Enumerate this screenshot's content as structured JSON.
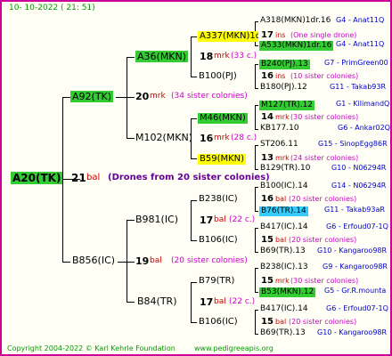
{
  "header": {
    "date": "10-  10-2022 (  21:  51)"
  },
  "footer": {
    "copyright": "Copyright 2004-2022 © Karl Kehrle Foundation",
    "site": "www.pedigreeapis.org"
  },
  "colors": {
    "green": "#33cc33",
    "yellow": "#ffff00",
    "cyan": "#33ccff",
    "frame": "#cc0099"
  },
  "root": {
    "id": "A20(TK)",
    "gen_num": "21",
    "mark": "bal",
    "note": "(Drones from 20 sister colonies)"
  },
  "sire": {
    "id": "A92(TK)",
    "gen_num": "20",
    "mark": "mrk",
    "note": "(34 sister colonies)",
    "s": {
      "id": "A36(MKN)",
      "gen_num": "18",
      "mark": "mrk",
      "note": "(33 c.)",
      "s": {
        "id": "A337(MKN)1dr",
        "gen_num": "17",
        "mark": "ins",
        "note": "(One single drone)",
        "s": {
          "id": "A318(MKN)1dr.16",
          "g": "G4 - Anat11Q"
        },
        "d": {
          "id": "A533(MKN)1dr.16",
          "g": "G4 - Anat11Q"
        }
      },
      "d": {
        "id": "B100(PJ)",
        "gen_num": "16",
        "mark": "ins",
        "note": "(10 sister colonies)",
        "s": {
          "id": "B240(PJ).13",
          "g": "G7 - PrimGreen00"
        },
        "d": {
          "id": "B180(PJ).12",
          "g": "G11 - Takab93R"
        }
      }
    },
    "d": {
      "id": "M102(MKN)",
      "gen_num": "16",
      "mark": "mrk",
      "note": "(28 c.)",
      "s": {
        "id": "M46(MKN)",
        "gen_num": "14",
        "mark": "mrk",
        "note": "(30 sister colonies)",
        "s": {
          "id": "M127(TR).12",
          "g": "G1 - KilimandQ"
        },
        "d": {
          "id": "KB177.10",
          "g": "G6 - Ankar02Q"
        }
      },
      "d": {
        "id": "B59(MKN)",
        "gen_num": "13",
        "mark": "mrk",
        "note": "(24 sister colonies)",
        "s": {
          "id": "ST206.11",
          "g": "G15 - SinopEgg86R"
        },
        "d": {
          "id": "B129(TR).10",
          "g": "G10 - N06294R"
        }
      }
    }
  },
  "dam": {
    "id": "B856(IC)",
    "gen_num": "19",
    "mark": "bal",
    "note": "(20 sister colonies)",
    "s": {
      "id": "B981(IC)",
      "gen_num": "17",
      "mark": "bal",
      "note": "(22 c.)",
      "s": {
        "id": "B238(IC)",
        "gen_num": "16",
        "mark": "bal",
        "note": "(20 sister colonies)",
        "s": {
          "id": "B100(IC).14",
          "g": "G14 - N06294R"
        },
        "d": {
          "id": "B76(TR).14",
          "g": "G11 - Takab93aR"
        }
      },
      "d": {
        "id": "B106(IC)",
        "gen_num": "15",
        "mark": "bal",
        "note": "(20 sister colonies)",
        "s": {
          "id": "B417(IC).14",
          "g": "G6 - Erfoud07-1Q"
        },
        "d": {
          "id": "B69(TR).13",
          "g": "G10 - Kangaroo98R"
        }
      }
    },
    "d": {
      "id": "B84(TR)",
      "gen_num": "17",
      "mark": "bal",
      "note": "(22 c.)",
      "s": {
        "id": "B79(TR)",
        "gen_num": "15",
        "mark": "mrk",
        "note": "(30 sister colonies)",
        "s": {
          "id": "B238(IC).13",
          "g": "G9 - Kangaroo98R"
        },
        "d": {
          "id": "B53(MKN).12",
          "g": "G5 - Gr.R.mounta"
        }
      },
      "d": {
        "id": "B106(IC)",
        "gen_num": "15",
        "mark": "bal",
        "note": "(20 sister colonies)",
        "s": {
          "id": "B417(IC).14",
          "g": "G6 - Erfoud07-1Q"
        },
        "d": {
          "id": "B69(TR).13",
          "g": "G10 - Kangaroo98R"
        }
      }
    }
  }
}
